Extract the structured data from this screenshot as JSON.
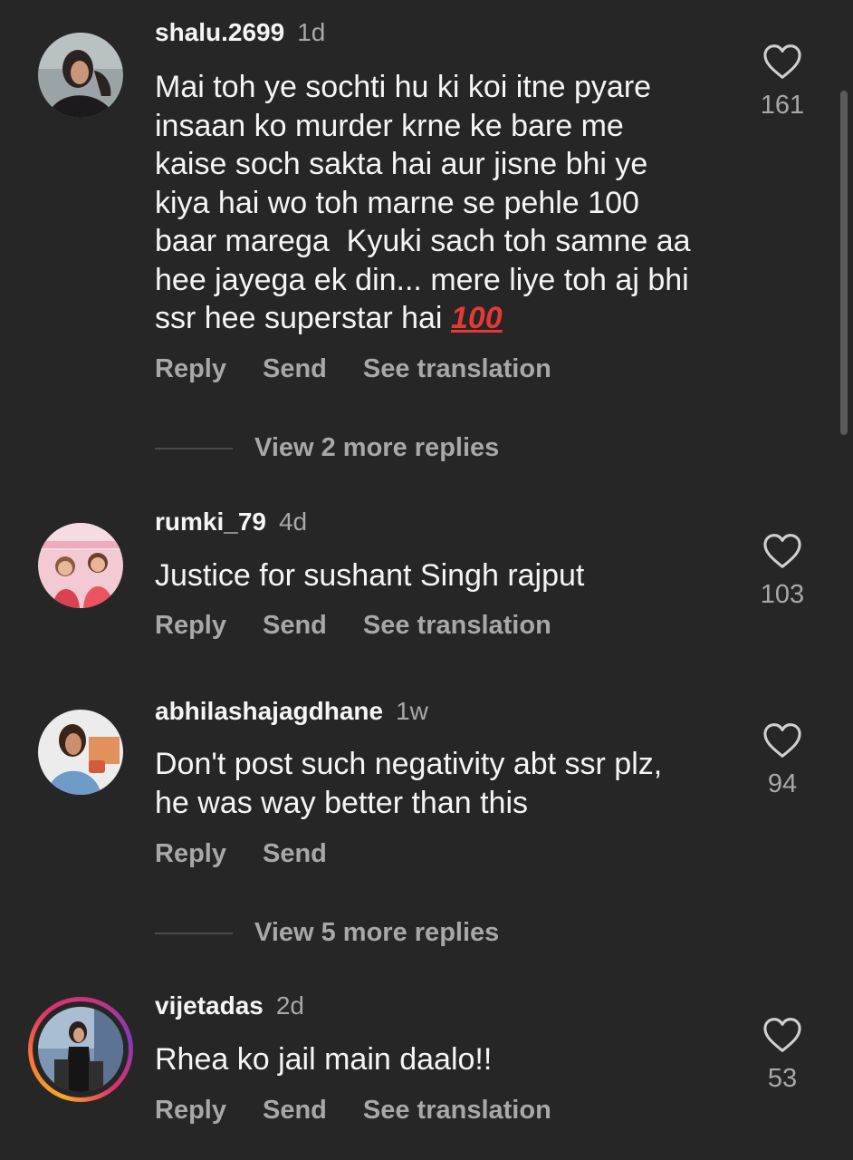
{
  "comments": [
    {
      "username": "shalu.2699",
      "time": "1d",
      "text": "Mai toh ye sochti hu ki koi itne pyare\ninsaan ko murder krne ke bare me\nkaise soch sakta hai aur jisne bhi ye\nkiya hai wo toh marne se pehle 100\nbaar marega  Kyuki sach toh samne aa\nhee jayega ek din... mere liye toh aj bhi\nssr hee superstar hai ",
      "emoji": "100",
      "likes": "161",
      "reply_label": "Reply",
      "send_label": "Send",
      "translate_label": "See translation",
      "view_replies": "View 2 more replies"
    },
    {
      "username": "rumki_79",
      "time": "4d",
      "text": "Justice for sushant Singh rajput",
      "likes": "103",
      "reply_label": "Reply",
      "send_label": "Send",
      "translate_label": "See translation"
    },
    {
      "username": "abhilashajagdhane",
      "time": "1w",
      "text": "Don't post such negativity abt ssr plz,\nhe was way better than this",
      "likes": "94",
      "reply_label": "Reply",
      "send_label": "Send",
      "view_replies": "View 5 more replies"
    },
    {
      "username": "vijetadas",
      "time": "2d",
      "text": "Rhea ko jail main daalo!!",
      "likes": "53",
      "reply_label": "Reply",
      "send_label": "Send",
      "translate_label": "See translation"
    }
  ],
  "colors": {
    "background": "#262626",
    "primary_text": "#f5f5f5",
    "secondary_text": "#a8a8a8",
    "emoji_red": "#e53935"
  },
  "icons": {
    "like": "heart-outline-icon"
  }
}
